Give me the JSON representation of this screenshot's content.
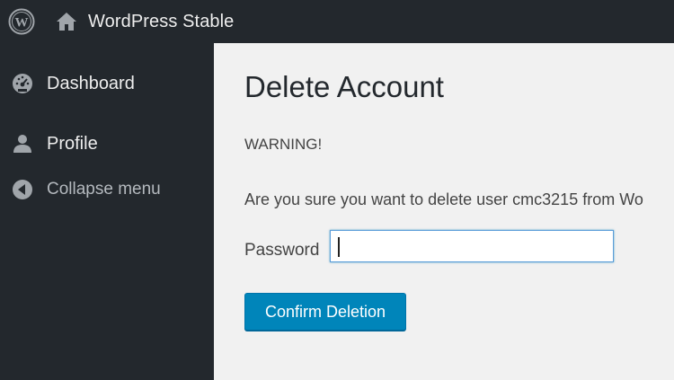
{
  "adminbar": {
    "logo_icon": "wordpress-logo-icon",
    "home_icon": "home-icon",
    "site_name": "WordPress Stable"
  },
  "sidebar": {
    "items": [
      {
        "label": "Dashboard",
        "icon": "dashboard-gauge-icon"
      },
      {
        "label": "Profile",
        "icon": "user-icon"
      },
      {
        "label": "Collapse menu",
        "icon": "collapse-arrow-icon"
      }
    ]
  },
  "main": {
    "title": "Delete Account",
    "warning": "WARNING!",
    "question": "Are you sure you want to delete user cmc3215 from Wo",
    "password_label": "Password",
    "password_value": "",
    "confirm_label": "Confirm Deletion"
  },
  "colors": {
    "admin_dark": "#23282d",
    "content_bg": "#f1f1f1",
    "button_blue": "#0085ba",
    "focus_blue": "#5b9dd9"
  }
}
